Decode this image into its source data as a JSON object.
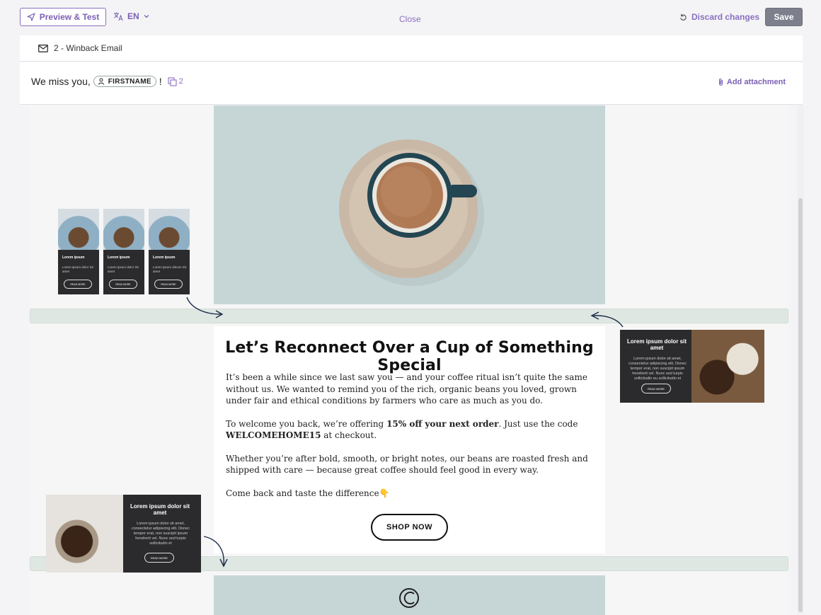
{
  "toolbar": {
    "preview_label": "Preview & Test",
    "language": "EN",
    "close_label": "Close",
    "discard_label": "Discard changes",
    "save_label": "Save"
  },
  "email": {
    "name": "2 - Winback Email"
  },
  "subject": {
    "prefix": "We miss you,",
    "token": "FIRSTNAME",
    "suffix": "!",
    "version_count": "2",
    "attachment_label": "Add attachment"
  },
  "content": {
    "title": "Let’s Reconnect Over a Cup of Something Special",
    "p1": "It’s been a while since we last saw you — and your coffee ritual isn’t quite the same without us. We wanted to remind you of the rich, organic beans you loved, grown under fair and ethical conditions by farmers who care as much as you do.",
    "p2_a": "To welcome you back, we’re offering ",
    "p2_bold": "15% off your next order",
    "p2_b": ". Just use the code ",
    "p2_code": "WELCOMEHOME15",
    "p2_c": " at checkout.",
    "p3": "Whether you’re after bold, smooth, or bright notes, our beans are roasted fresh and shipped with care — because great coffee should feel good in every way.",
    "p4": "Come back and taste the difference👇",
    "button": "SHOP NOW"
  },
  "mini_cards": [
    {
      "title": "Lorem ipsum",
      "text": "Lorem ipsum dolor Sit amet",
      "button": "READ MORE"
    },
    {
      "title": "Lorem ipsum",
      "text": "Lorem ipsum dolor Sit amet",
      "button": "READ MORE"
    },
    {
      "title": "Lorem ipsum",
      "text": "Lorem ipsum dolons Sit amet",
      "button": "READ MORE"
    }
  ],
  "card_right": {
    "title": "Lorem ipsum dolor sit amet",
    "text": "Lorem ipsum dolor sit amet, consectetur adipiscing elit. Donec tempor erat, non suscipit ipsum hendrerit vel. Nunc sed turpis sollicitudin eu sollicitudin et",
    "button": "READ MORE"
  },
  "card_left": {
    "title": "Lorem ipsum dolor sit amet",
    "text": "Lorem ipsum dolor sit amet, consectetur adipiscing elit. Donec tempor erat, non suscipit ipsum hendrerit vel. Nunc sed turpis sollicitudin et",
    "button": "READ MORE"
  },
  "colors": {
    "accent": "#7b5fb4",
    "save_bg": "#7d7f8c",
    "hero_bg": "#c6d6d6",
    "divider_bg": "#dfe7e3",
    "card_bg": "#2b2b2d"
  }
}
